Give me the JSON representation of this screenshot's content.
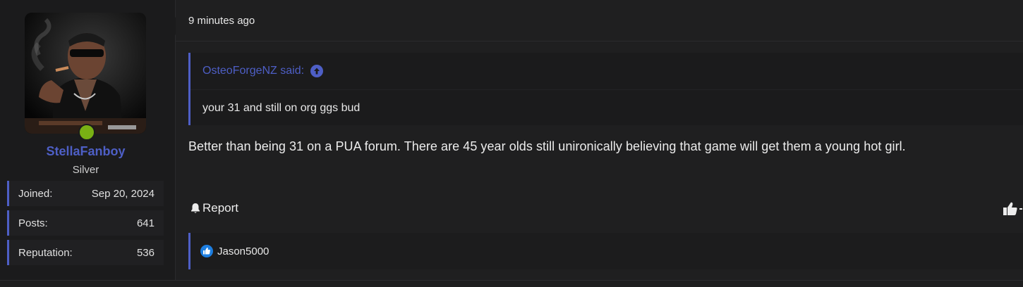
{
  "user": {
    "username": "StellaFanboy",
    "title": "Silver",
    "online_color": "#79b014",
    "stats": [
      {
        "label": "Joined:",
        "value": "Sep 20, 2024"
      },
      {
        "label": "Posts:",
        "value": "641"
      },
      {
        "label": "Reputation:",
        "value": "536"
      }
    ]
  },
  "post": {
    "time": "9 minutes ago",
    "quote": {
      "author_line": "OsteoForgeNZ said:",
      "icon": "arrow-up-circle-icon",
      "text": "your 31 and still on org ggs bud"
    },
    "message": "Better than being 31 on a PUA forum. There are 45 year olds still unironically believing that game will get them a young hot girl.",
    "report_label": "Report",
    "reactions": {
      "icon": "like-icon",
      "users": "Jason5000"
    }
  },
  "colors": {
    "accent": "#4e5fc6",
    "background": "#1f1f20",
    "panel": "#1b1b1c"
  }
}
